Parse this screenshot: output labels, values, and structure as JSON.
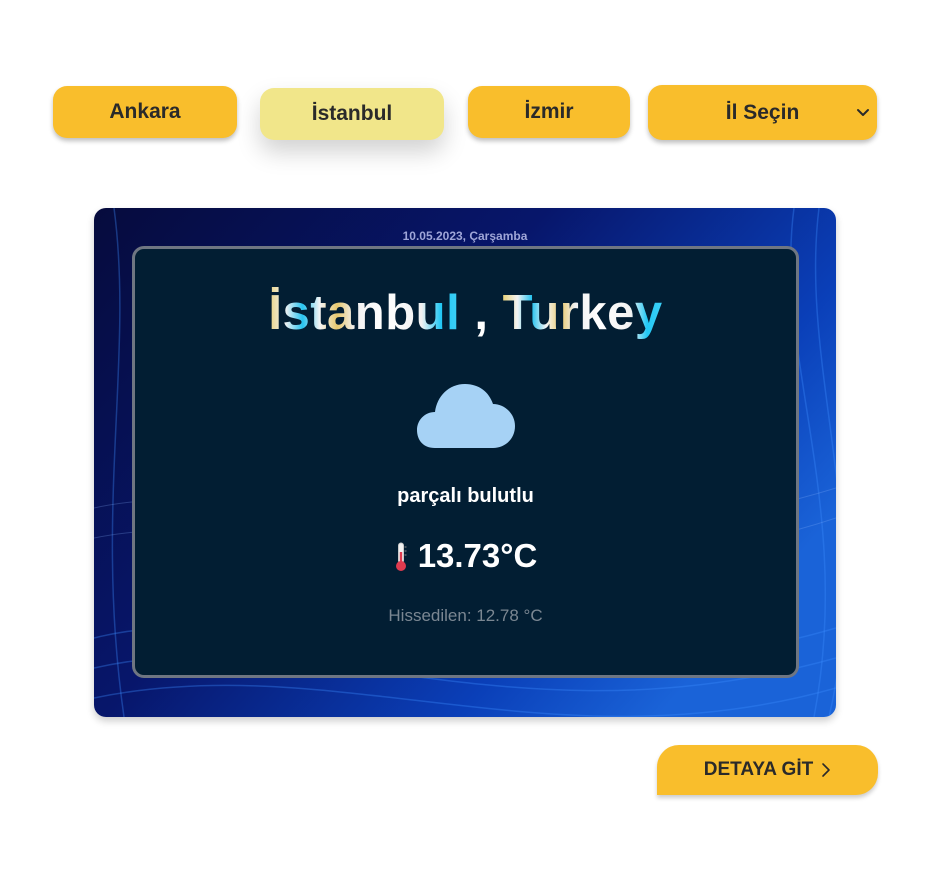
{
  "city_buttons": [
    {
      "label": "Ankara",
      "active": false
    },
    {
      "label": "İstanbul",
      "active": true
    },
    {
      "label": "İzmir",
      "active": false
    }
  ],
  "city_select": {
    "selected": "İl Seçin",
    "icon": "chevron-down-icon"
  },
  "weather": {
    "date": "10.05.2023, Çarşamba",
    "city": "İstanbul",
    "separator": " , ",
    "country": "Turkey",
    "condition_icon": "cloud-icon",
    "description": "parçalı bulutlu",
    "temperature_icon": "thermometer-icon",
    "temperature": "13.73°C",
    "feels_like": "Hissedilen: 12.78 °C"
  },
  "detail_button": {
    "label": "DETAYA GİT",
    "icon": "chevron-right-icon"
  },
  "colors": {
    "button": "#f9be2c",
    "button_active": "#f1e68a",
    "card_inner": "#021e33",
    "cloud": "#a6d2f5"
  }
}
